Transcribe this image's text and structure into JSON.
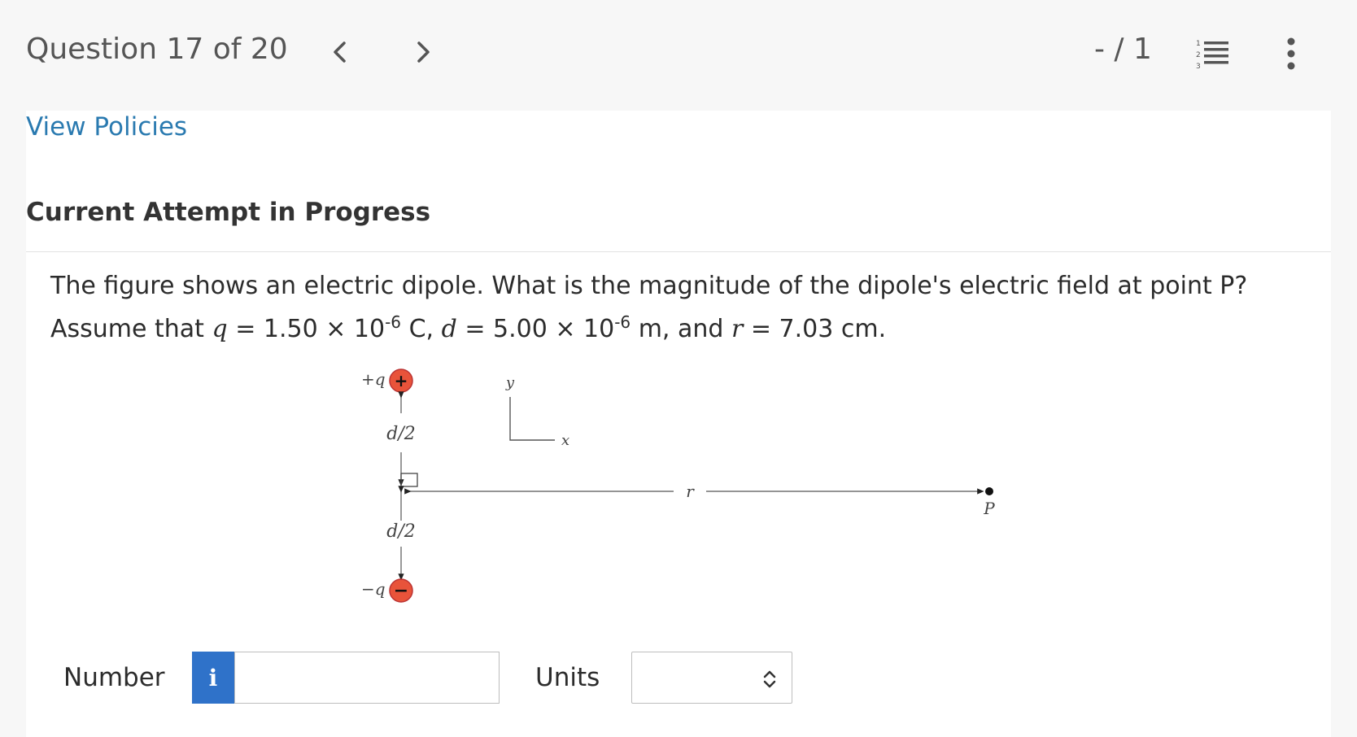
{
  "header": {
    "question_title": "Question 17 of 20",
    "score": "- / 1",
    "prev_icon": "chevron-left-icon",
    "next_icon": "chevron-right-icon",
    "list_icon": "numbered-list-icon",
    "more_icon": "vertical-ellipsis-icon"
  },
  "links": {
    "view_policies": "View Policies"
  },
  "attempt": {
    "status": "Current Attempt in Progress"
  },
  "question": {
    "part1": "The figure shows an electric dipole. What is the magnitude of the dipole's electric field at point P? Assume that ",
    "q_var": "q",
    "part2": " = 1.50 × 10",
    "exp1": "-6",
    "part3": " C, ",
    "d_var": "d",
    "part4": " = 5.00 × 10",
    "exp2": "-6",
    "part5": " m, and ",
    "r_var": "r",
    "part6": " = 7.03 cm."
  },
  "figure": {
    "plus_label": "+q",
    "minus_label": "−q",
    "plus_sign": "+",
    "minus_sign": "−",
    "half_d_top": "d/2",
    "half_d_bottom": "d/2",
    "r_label": "r",
    "p_label": "P",
    "y_axis": "y",
    "x_axis": "x",
    "charge_color": "#e8533a"
  },
  "answer": {
    "number_label": "Number",
    "info_icon_text": "i",
    "number_value": "",
    "units_label": "Units",
    "units_selected": ""
  }
}
